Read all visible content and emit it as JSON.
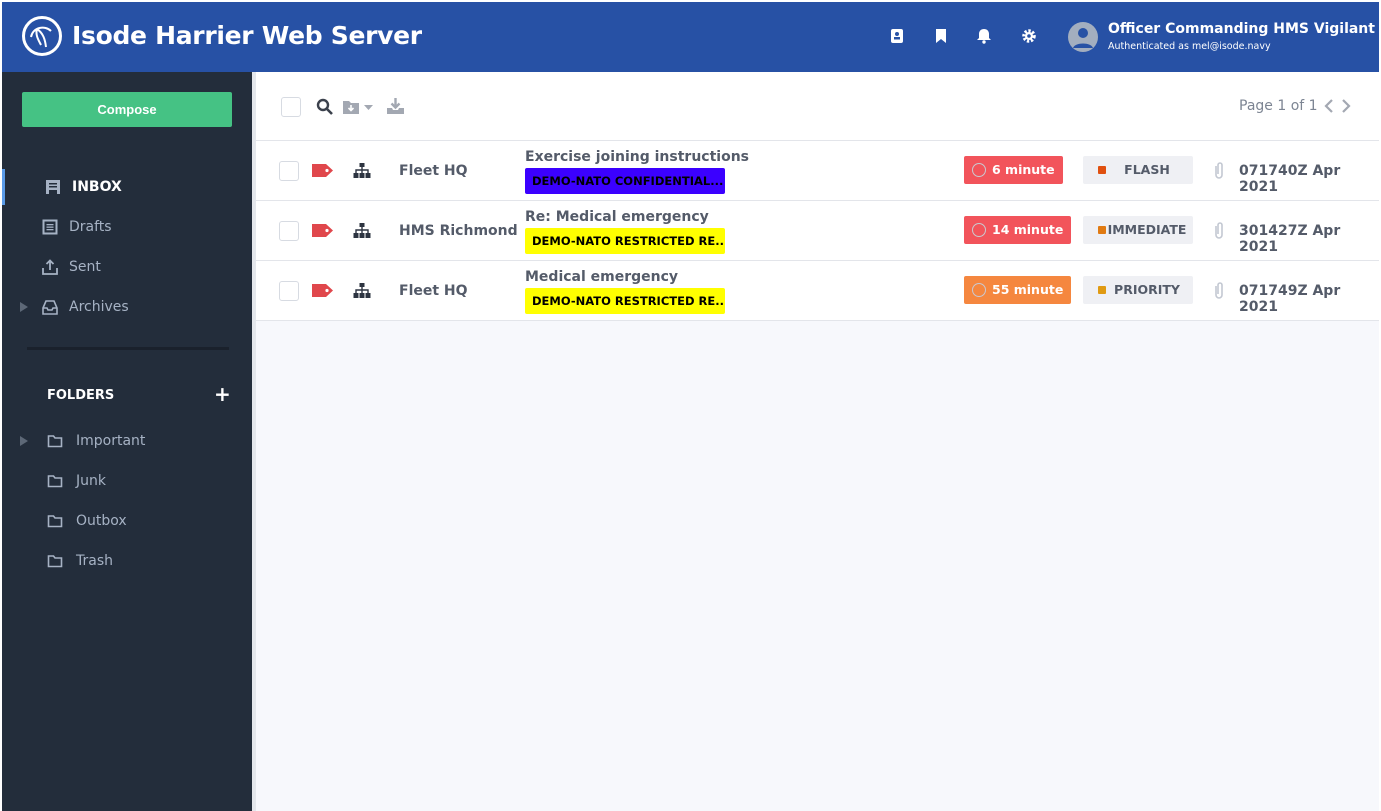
{
  "header": {
    "title": "Isode Harrier Web Server",
    "user_name": "Officer Commanding HMS Vigilant",
    "auth": "Authenticated as mel@isode.navy",
    "icons": [
      "address-book-icon",
      "bookmark-icon",
      "bell-icon",
      "gear-icon"
    ]
  },
  "sidebar": {
    "compose": "Compose",
    "nav": [
      {
        "label": "INBOX",
        "icon": "inbox-icon"
      },
      {
        "label": "Drafts",
        "icon": "drafts-icon"
      },
      {
        "label": "Sent",
        "icon": "upload-icon"
      },
      {
        "label": "Archives",
        "icon": "archive-tray-icon"
      }
    ],
    "folders_heading": "FOLDERS",
    "add": "+",
    "folders": [
      {
        "label": "Important"
      },
      {
        "label": "Junk"
      },
      {
        "label": "Outbox"
      },
      {
        "label": "Trash"
      }
    ]
  },
  "toolbar": {
    "pager": "Page 1 of 1"
  },
  "messages": [
    {
      "from": "Fleet HQ",
      "subject": "Exercise joining instructions",
      "label": "DEMO-NATO CONFIDENTIAL...",
      "label_color": "#3b00ff",
      "timer": "6 minute",
      "timer_color": "#f2545b",
      "precedence": "FLASH",
      "prec_color": "#e0500f",
      "dtg": "071740Z Apr 2021"
    },
    {
      "from": "HMS Richmond",
      "subject": "Re: Medical emergency",
      "label": "DEMO-NATO RESTRICTED RE...",
      "label_color": "#ffff00",
      "timer": "14 minute",
      "timer_color": "#f2545b",
      "precedence": "IMMEDIATE",
      "prec_color": "#e07a12",
      "dtg": "301427Z Apr 2021"
    },
    {
      "from": "Fleet HQ",
      "subject": "Medical emergency",
      "label": "DEMO-NATO RESTRICTED RE...",
      "label_color": "#ffff00",
      "timer": "55 minute",
      "timer_color": "#f5873f",
      "precedence": "PRIORITY",
      "prec_color": "#e09a12",
      "dtg": "071749Z Apr 2021"
    }
  ]
}
